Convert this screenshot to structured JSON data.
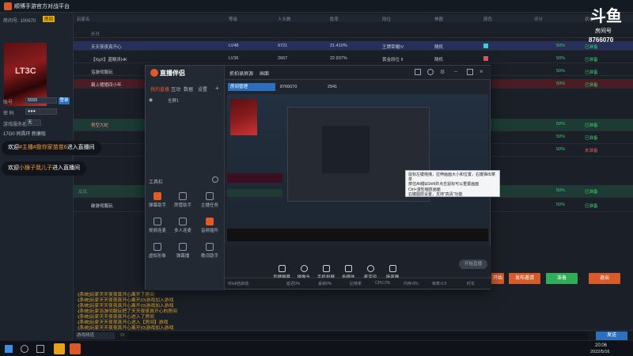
{
  "app": {
    "title": "顺博手游官方对战平台",
    "room_label": "房间号: 100670",
    "room_tag": "房间",
    "account_label": "账号",
    "account_value": "5555",
    "password_label": "密 码",
    "password_value": "●●●",
    "login_btn": "登录",
    "game_label": "游戏服务器",
    "game_value": "无",
    "id_text": "17G0 同昌环 新廉阪",
    "avatar_text": "LT3C"
  },
  "table": {
    "headers": [
      "玩家名",
      "等级",
      "人头数",
      "胜率",
      "段位",
      "神器",
      "颜色",
      "评分",
      "状态"
    ],
    "rows": [
      {
        "name": "开开",
        "level": "",
        "kills": "",
        "rate": "",
        "rank": "",
        "artifact": "",
        "score": "",
        "state": ""
      },
      {
        "name": "天天夜夜真开心",
        "level": "LV48",
        "kills": "9721",
        "rate": "21.410%",
        "rank": "王牌荣耀IV",
        "artifact": "随机",
        "score": "50%",
        "state": "已准备"
      },
      {
        "name": "【XgX】蓝精灵HK",
        "level": "LV36",
        "kills": "2667",
        "rate": "22.937%",
        "rank": "黄金段位 II",
        "artifact": "随机",
        "score": "50%",
        "state": "已准备"
      },
      {
        "name": "浴游伺服玩",
        "level": "",
        "kills": "",
        "rate": "",
        "rank": "",
        "artifact": "",
        "score": "50%",
        "state": "已准备"
      },
      {
        "name": "霸上猪猪四小年",
        "level": "",
        "kills": "",
        "rate": "",
        "rank": "",
        "artifact": "",
        "score": "50%",
        "state": "已准备"
      },
      {
        "name": "男型大蛇",
        "level": "",
        "kills": "",
        "rate": "",
        "rank": "",
        "artifact": "",
        "score": "50%",
        "state": "已准备"
      },
      {
        "name": "",
        "level": "",
        "kills": "",
        "rate": "",
        "rank": "",
        "artifact": "",
        "score": "50%",
        "state": "已准备"
      },
      {
        "name": "",
        "level": "",
        "kills": "",
        "rate": "",
        "rank": "",
        "artifact": "",
        "score": "50%",
        "state": "未准备"
      },
      {
        "name": "瓜瓜",
        "level": "",
        "kills": "",
        "rate": "",
        "rank": "",
        "artifact": "",
        "score": "50%",
        "state": "已准备"
      },
      {
        "name": "破游伺服玩",
        "level": "",
        "kills": "",
        "rate": "",
        "rank": "",
        "artifact": "",
        "score": "50%",
        "state": "已准备"
      }
    ]
  },
  "chat": {
    "msg1_prefix": "欢迎",
    "msg1_name": "#主播#掀你家苗苗6",
    "msg1_suffix": "进入直播间",
    "msg2_prefix": "欢迎",
    "msg2_name": "小猴子我儿子",
    "msg2_suffix": "进入直播间"
  },
  "logs": [
    "-[系统]玩家天天夜夜真开心离开了房间",
    "-[系统]玩家天天夜夜真开心离开(0)游戏加入游戏",
    "-[系统]玩家天天夜夜真开心离开(0)游戏加入游戏",
    "-[系统]玩家浴游伺服玩把了天天夜夜真开心的房间",
    "-[系统]玩家天天夜夜真开心进入了房间",
    "-[系统]玩家天天夜夜真开心进入【房间】游戏",
    "-[系统]玩家天天夜夜真开心离开(0)游戏加入游戏"
  ],
  "actions": {
    "start": "开始",
    "send_msg": "发布邀请",
    "ready": "准备",
    "exit": "退出"
  },
  "input": {
    "placeholder": "游戏频道",
    "send": "发送"
  },
  "taskbar": {
    "time": "20:06",
    "date": "2022/5/16"
  },
  "douyu": {
    "logo": "斗鱼",
    "room_label": "房间号",
    "room_number": "8766070"
  },
  "popup": {
    "brand": "直播伴侣",
    "left_tabs": [
      "我的直播",
      "互动",
      "数据",
      "设置"
    ],
    "head_tabs": [
      "抓拍录屏源",
      "画面"
    ],
    "room_name": "房间管理 ",
    "room_id": "8766070",
    "fans": "2941",
    "scene_label": "全屏1",
    "tool_title": "工具栏",
    "tools": [
      {
        "label": "弹幕助手",
        "red": true
      },
      {
        "label": "房管助手",
        "red": false
      },
      {
        "label": "主播任务",
        "red": false
      },
      {
        "label": "视频连麦",
        "red": false
      },
      {
        "label": "多人连麦",
        "red": false
      },
      {
        "label": "音频插件",
        "red": true
      },
      {
        "label": "虚拟形象",
        "red": false
      },
      {
        "label": "弹幕播",
        "red": false
      },
      {
        "label": "歌词助手",
        "red": false
      }
    ],
    "bottom_tools": [
      "直播屏幕",
      "摄像头",
      "手机投屏",
      "多媒体",
      "麦克风",
      "扬声器"
    ],
    "start_btn": "开始直播",
    "tooltip_lines": [
      "鼠标左键拖拽，拉伸画面大小和位置，右键弹出菜单",
      "按住Alt键&Shift并点击鼠标可以重置画面",
      "Ctrl+滚轮缩放画面",
      "右键图层设置，支持\"高清\"功能"
    ],
    "status": [
      "Win8自启动",
      "延迟0%",
      "丢帧0%",
      "比特率",
      "CPU:2%",
      "内存:0%",
      "帧率:0.0",
      "时长"
    ]
  }
}
